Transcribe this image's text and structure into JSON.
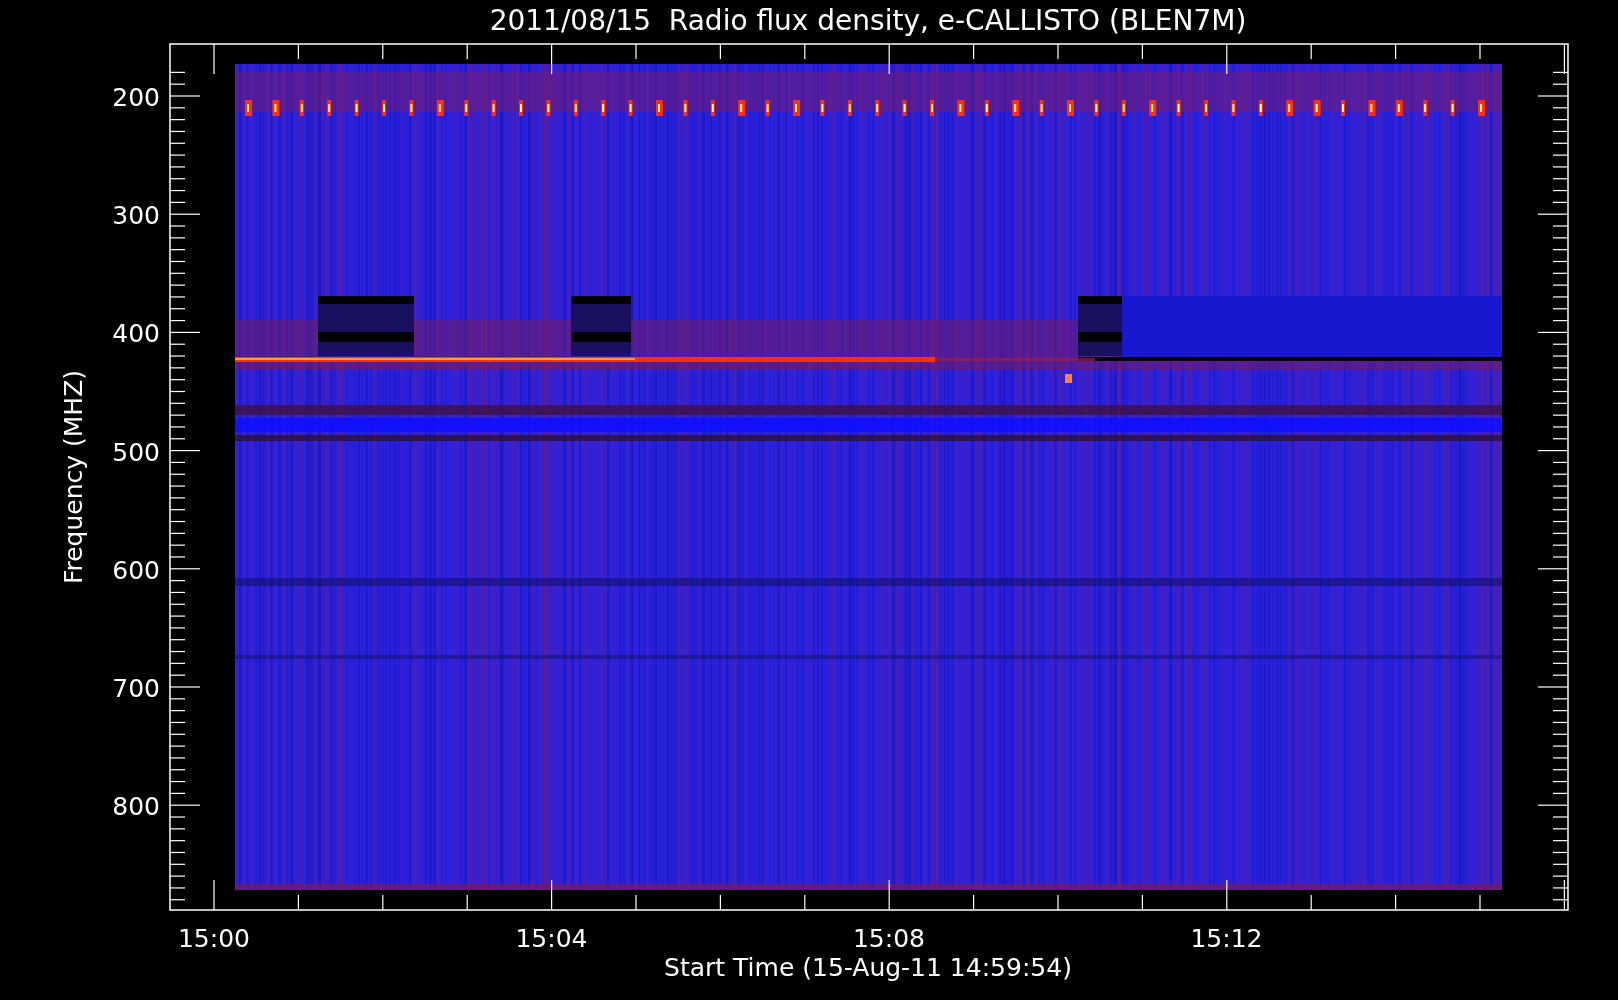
{
  "plot": {
    "title": "2011/08/15  Radio flux density, e-CALLISTO (BLEN7M)",
    "ylabel": "Frequency (MHZ)",
    "xlabel": "Start Time (15-Aug-11 14:59:54)",
    "yticks": [
      "200",
      "300",
      "400",
      "500",
      "600",
      "700",
      "800"
    ],
    "xticks": [
      "15:00",
      "15:04",
      "15:08",
      "15:12"
    ]
  }
}
